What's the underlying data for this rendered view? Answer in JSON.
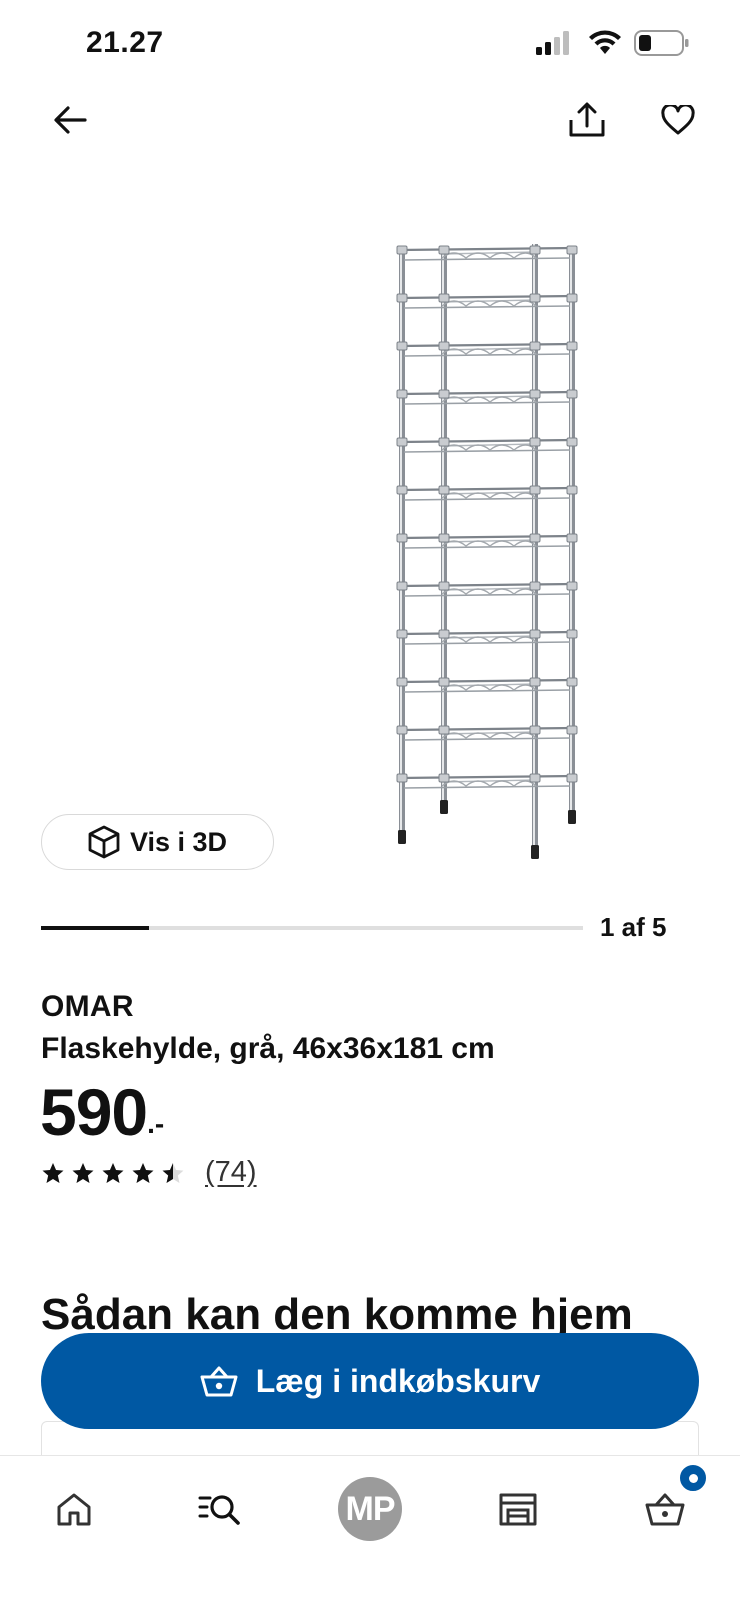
{
  "status_bar": {
    "time": "21.27",
    "icons": [
      "cellular-signal-icon",
      "wifi-icon",
      "battery-icon"
    ]
  },
  "top_nav": {
    "icons": [
      "arrow-left-icon",
      "share-icon",
      "heart-icon"
    ]
  },
  "product": {
    "image_icon": "wine-rack-image",
    "view_3d_label": "Vis i 3D",
    "gallery": {
      "counter": "1 af 5",
      "current": 1,
      "total": 5,
      "progress": 0.2
    },
    "brand": "OMAR",
    "description": "Flaskehylde, grå, 46x36x181 cm",
    "price": {
      "amount": "590",
      "suffix": ".-"
    },
    "rating": {
      "value": 4.5,
      "max": 5,
      "count_label": "(74)"
    }
  },
  "delivery": {
    "heading": "Sådan kan den komme hjem"
  },
  "cart_button": {
    "label": "Læg i indkøbskurv"
  },
  "bottom_nav": {
    "tabs": [
      {
        "icon": "home-icon"
      },
      {
        "icon": "search-list-icon"
      },
      {
        "icon": "profile-avatar",
        "initials": "MP"
      },
      {
        "icon": "store-icon"
      },
      {
        "icon": "basket-icon",
        "badge": true
      }
    ]
  },
  "colors": {
    "primary_blue": "#0058a3",
    "text": "#111111",
    "avatar_grey": "#9b9b9b",
    "divider": "#dfdfdf"
  }
}
